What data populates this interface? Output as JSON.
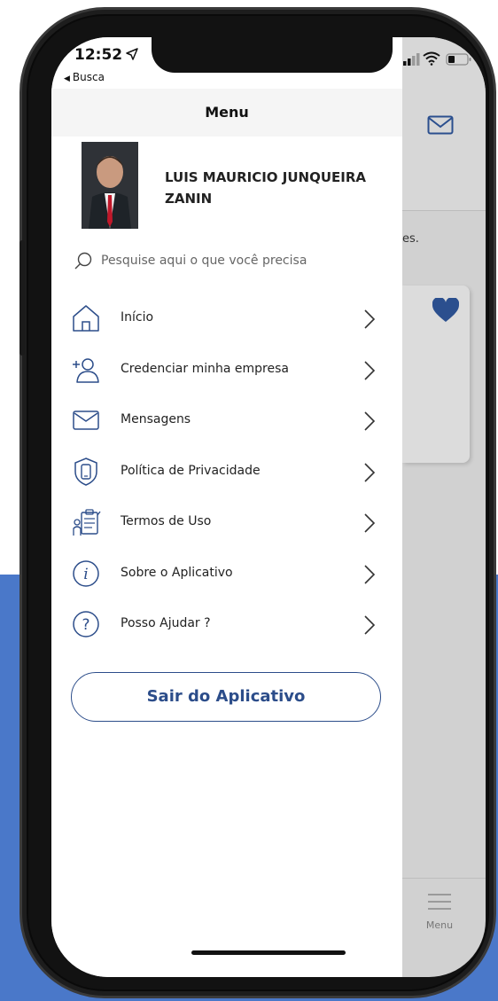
{
  "status_bar": {
    "time": "12:52",
    "back_label": "Busca"
  },
  "drawer": {
    "title": "Menu",
    "user_name": "LUIS MAURICIO JUNQUEIRA ZANIN",
    "search_placeholder": "Pesquise aqui o que você precisa",
    "items": [
      {
        "label": "Início",
        "icon": "home-icon"
      },
      {
        "label": "Credenciar minha empresa",
        "icon": "add-user-icon"
      },
      {
        "label": "Mensagens",
        "icon": "envelope-icon"
      },
      {
        "label": "Política de Privacidade",
        "icon": "shield-phone-icon"
      },
      {
        "label": "Termos de Uso",
        "icon": "clipboard-person-icon"
      },
      {
        "label": "Sobre o Aplicativo",
        "icon": "info-icon"
      },
      {
        "label": "Posso Ajudar ?",
        "icon": "help-icon"
      }
    ],
    "logout_label": "Sair do Aplicativo"
  },
  "background_screen": {
    "text_fragment": "es.",
    "bottom_nav_label": "Menu"
  },
  "colors": {
    "accent": "#2c4d8a",
    "page_blue": "#4a78c9",
    "heart": "#2b4f8e"
  }
}
